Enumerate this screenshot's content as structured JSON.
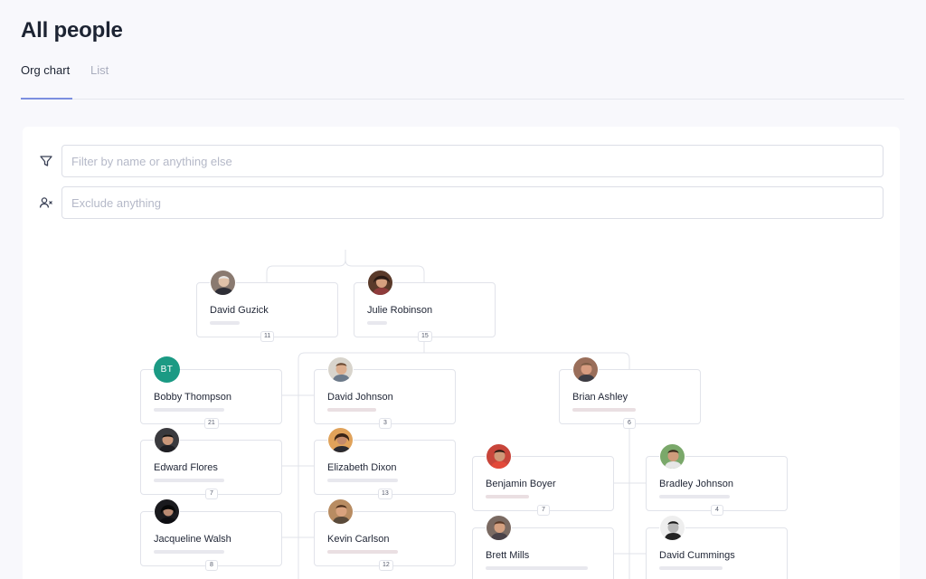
{
  "page": {
    "title": "All people"
  },
  "tabs": [
    {
      "label": "Org chart",
      "active": true
    },
    {
      "label": "List",
      "active": false
    }
  ],
  "filters": {
    "filter_placeholder": "Filter by name or anything else",
    "filter_icon": "filter-icon",
    "exclude_placeholder": "Exclude anything",
    "exclude_icon": "user-exclude-icon"
  },
  "colors": {
    "accent": "#7c8fe0",
    "initials_avatar": "#1b9a84"
  },
  "people": {
    "david_guzick": {
      "name": "David Guzick",
      "reports": "11"
    },
    "julie_robinson": {
      "name": "Julie Robinson",
      "reports": "15"
    },
    "bobby_thompson": {
      "name": "Bobby Thompson",
      "initials": "BT",
      "reports": "21"
    },
    "edward_flores": {
      "name": "Edward Flores",
      "reports": "7"
    },
    "jacqueline_walsh": {
      "name": "Jacqueline Walsh",
      "reports": "8"
    },
    "david_johnson": {
      "name": "David Johnson",
      "reports": "3"
    },
    "elizabeth_dixon": {
      "name": "Elizabeth Dixon",
      "reports": "13"
    },
    "kevin_carlson": {
      "name": "Kevin Carlson",
      "reports": "12"
    },
    "brian_ashley": {
      "name": "Brian Ashley",
      "reports": "6"
    },
    "benjamin_boyer": {
      "name": "Benjamin Boyer",
      "reports": "7"
    },
    "bradley_johnson": {
      "name": "Bradley Johnson",
      "reports": "4"
    },
    "brett_mills": {
      "name": "Brett Mills"
    },
    "david_cummings": {
      "name": "David Cummings"
    }
  }
}
